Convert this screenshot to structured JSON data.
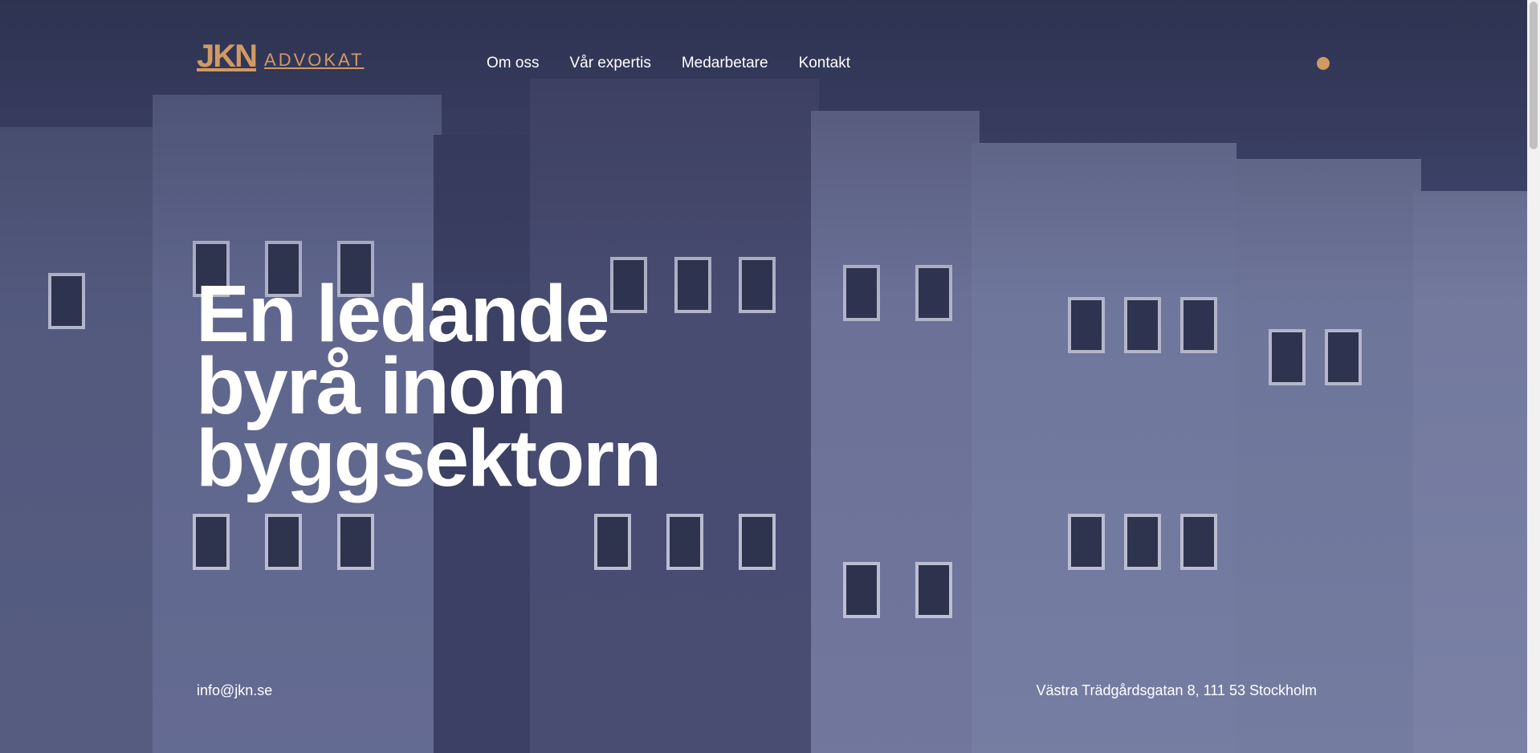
{
  "logo": {
    "mark": "JKN",
    "text": "ADVOKAT"
  },
  "nav": {
    "items": [
      "Om oss",
      "Vår expertis",
      "Medarbetare",
      "Kontakt"
    ]
  },
  "menu": {
    "icon": "menu-dot-icon",
    "color": "#d29a63"
  },
  "hero": {
    "headline_line1": "En ledande",
    "headline_line2": "byrå inom",
    "headline_line3": "byggsektorn"
  },
  "footer": {
    "email": "info@jkn.se",
    "address": "Västra Trädgårdsgatan 8, 111 53 Stockholm"
  },
  "colors": {
    "accent": "#d29a63",
    "overlay": "#3d4468",
    "text": "#ffffff"
  }
}
